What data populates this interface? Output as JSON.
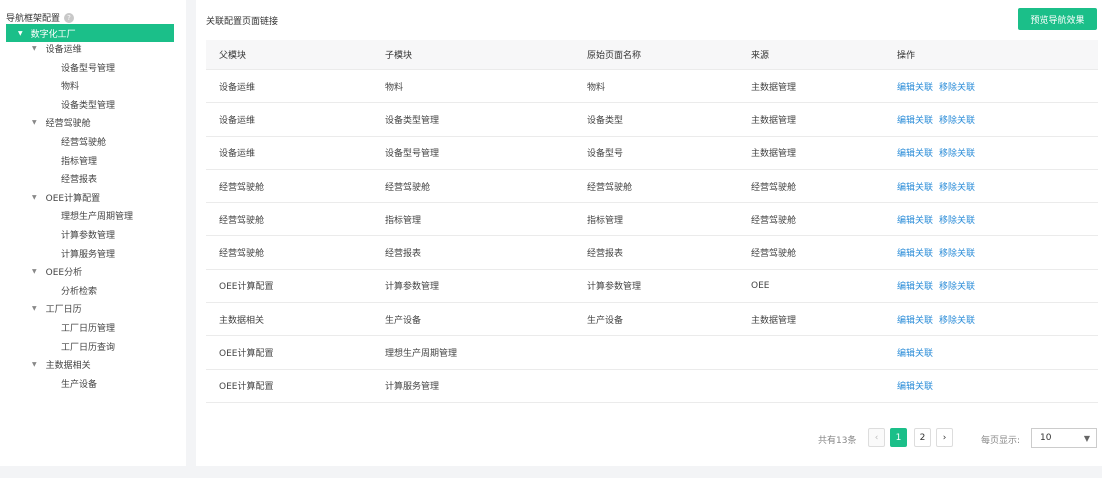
{
  "sidebar": {
    "title": "导航框架配置",
    "help_icon": "question-icon",
    "root": "数字化工厂",
    "groups": [
      {
        "label": "设备运维",
        "children": [
          "设备型号管理",
          "物料",
          "设备类型管理"
        ]
      },
      {
        "label": "经营驾驶舱",
        "children": [
          "经营驾驶舱",
          "指标管理",
          "经营报表"
        ]
      },
      {
        "label": "OEE计算配置",
        "children": [
          "理想生产周期管理",
          "计算参数管理",
          "计算服务管理"
        ]
      },
      {
        "label": "OEE分析",
        "children": [
          "分析检索"
        ]
      },
      {
        "label": "工厂日历",
        "children": [
          "工厂日历管理",
          "工厂日历查询"
        ]
      },
      {
        "label": "主数据相关",
        "children": [
          "生产设备"
        ]
      }
    ]
  },
  "main": {
    "title": "关联配置页面链接",
    "preview_button": "预览导航效果",
    "columns": [
      "父模块",
      "子模块",
      "原始页面名称",
      "来源",
      "操作"
    ],
    "rows": [
      [
        "设备运维",
        "物料",
        "物料",
        "主数据管理"
      ],
      [
        "设备运维",
        "设备类型管理",
        "设备类型",
        "主数据管理"
      ],
      [
        "设备运维",
        "设备型号管理",
        "设备型号",
        "主数据管理"
      ],
      [
        "经营驾驶舱",
        "经营驾驶舱",
        "经营驾驶舱",
        "经营驾驶舱"
      ],
      [
        "经营驾驶舱",
        "指标管理",
        "指标管理",
        "经营驾驶舱"
      ],
      [
        "经营驾驶舱",
        "经营报表",
        "经营报表",
        "经营驾驶舱"
      ],
      [
        "OEE计算配置",
        "计算参数管理",
        "计算参数管理",
        "OEE"
      ],
      [
        "主数据相关",
        "生产设备",
        "生产设备",
        "主数据管理"
      ],
      [
        "OEE计算配置",
        "理想生产周期管理",
        "",
        ""
      ],
      [
        "OEE计算配置",
        "计算服务管理",
        "",
        ""
      ]
    ],
    "actions": {
      "edit": "编辑关联",
      "remove": "移除关联"
    },
    "pagination": {
      "total": "共有13条",
      "prev": "‹",
      "pages": [
        "1",
        "2"
      ],
      "current": "1",
      "next": "›",
      "per_page_label": "每页显示:",
      "per_page_value": "10"
    }
  },
  "colors": {
    "accent": "#1bbf89",
    "link": "#2a8cd8"
  }
}
